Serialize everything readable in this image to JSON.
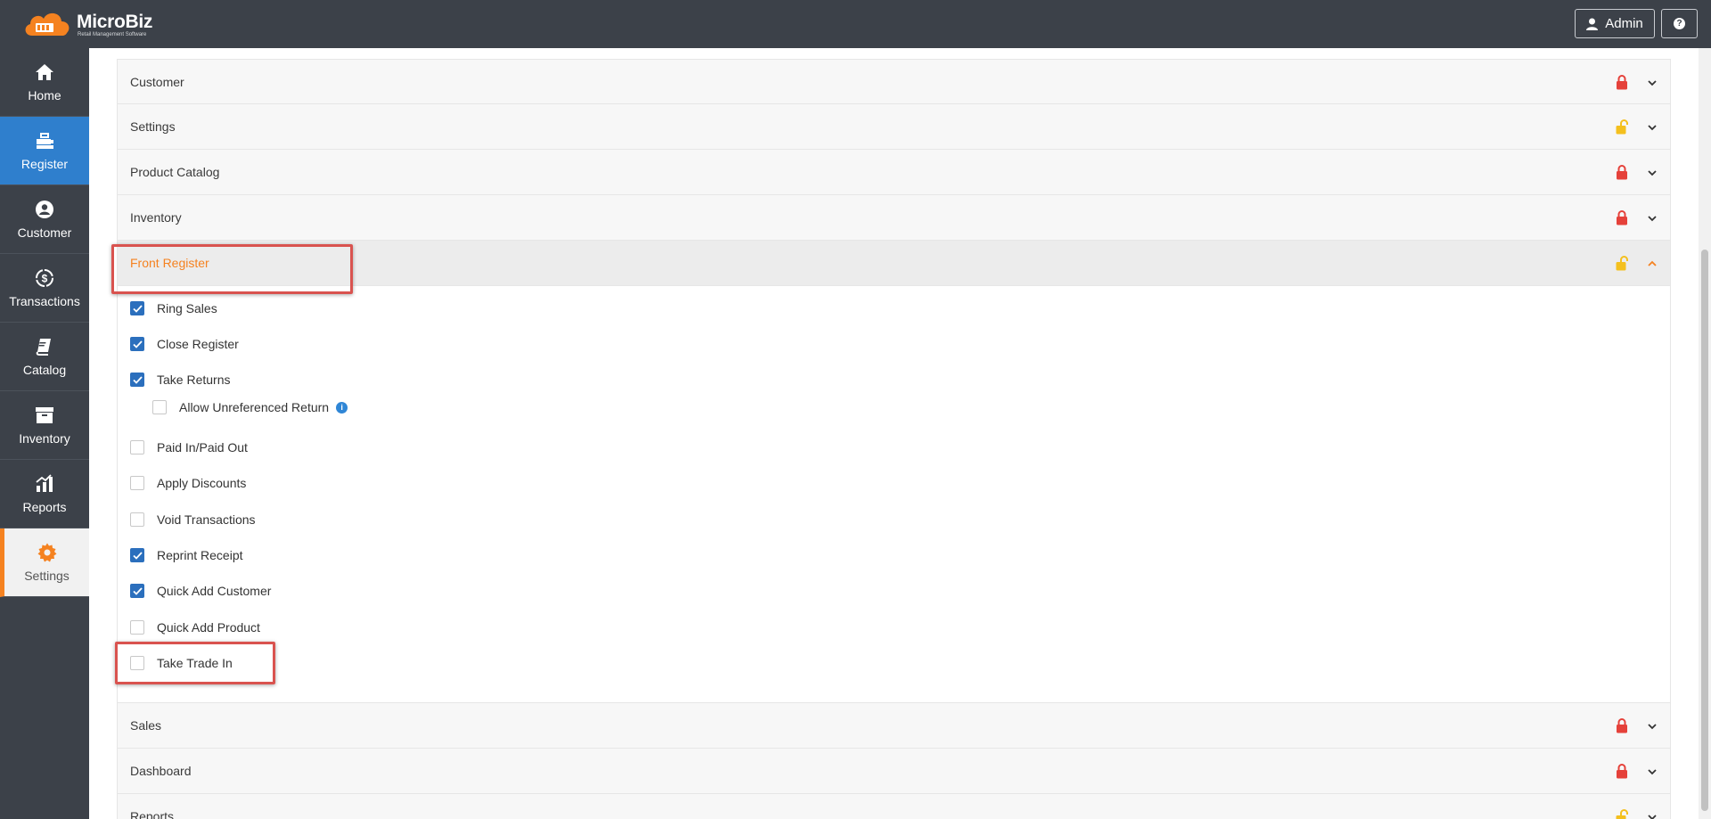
{
  "app": {
    "brand": "MicroBiz",
    "tagline": "Retail Management Software",
    "user_button": "Admin",
    "help_label": "?"
  },
  "sidebar": {
    "items": [
      {
        "label": "Home",
        "icon": "home-icon"
      },
      {
        "label": "Register",
        "icon": "register-icon"
      },
      {
        "label": "Customer",
        "icon": "user-circle-icon"
      },
      {
        "label": "Transactions",
        "icon": "dollar-cycle-icon"
      },
      {
        "label": "Catalog",
        "icon": "book-icon"
      },
      {
        "label": "Inventory",
        "icon": "archive-box-icon"
      },
      {
        "label": "Reports",
        "icon": "chart-bars-icon"
      },
      {
        "label": "Settings",
        "icon": "gear-icon"
      }
    ]
  },
  "sections": {
    "customer": {
      "label": "Customer",
      "lock": "locked"
    },
    "settings": {
      "label": "Settings",
      "lock": "unlocked"
    },
    "product_catalog": {
      "label": "Product Catalog",
      "lock": "locked"
    },
    "inventory": {
      "label": "Inventory",
      "lock": "locked"
    },
    "front_register": {
      "label": "Front Register",
      "lock": "unlocked"
    },
    "sales": {
      "label": "Sales",
      "lock": "locked"
    },
    "dashboard": {
      "label": "Dashboard",
      "lock": "locked"
    },
    "reports": {
      "label": "Reports",
      "lock": "unlocked"
    }
  },
  "permissions": [
    {
      "label": "Ring Sales",
      "checked": true
    },
    {
      "label": "Close Register",
      "checked": true
    },
    {
      "label": "Take Returns",
      "checked": true
    },
    {
      "label": "Allow Unreferenced Return",
      "checked": false,
      "info": "i"
    },
    {
      "label": "Paid In/Paid Out",
      "checked": false
    },
    {
      "label": "Apply Discounts",
      "checked": false
    },
    {
      "label": "Void Transactions",
      "checked": false
    },
    {
      "label": "Reprint Receipt",
      "checked": true
    },
    {
      "label": "Quick Add Customer",
      "checked": true
    },
    {
      "label": "Quick Add Product",
      "checked": false
    },
    {
      "label": "Take Trade In",
      "checked": false
    }
  ],
  "colors": {
    "accent_orange": "#f58220",
    "checkbox_blue": "#2b6fbd",
    "lock_red": "#e5413a",
    "lock_yellow": "#f4c01e",
    "highlight_red": "#d9534f"
  }
}
